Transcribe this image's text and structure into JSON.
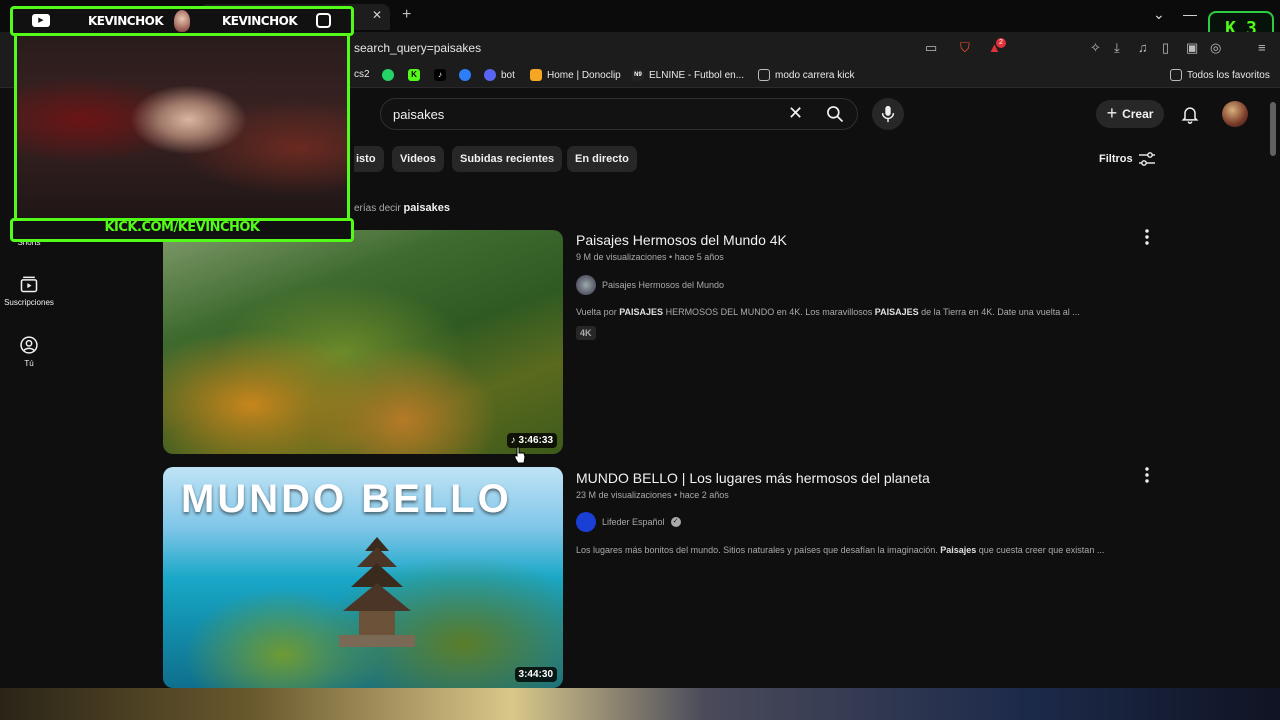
{
  "browser": {
    "url": "search_query=paisakes",
    "badge_letter": "K",
    "badge_count": "3",
    "bookmarks": [
      {
        "label": "cs2",
        "icon": "bookmark-icon"
      },
      {
        "label": "",
        "icon": "whatsapp-icon"
      },
      {
        "label": "",
        "icon": "tiktok-icon"
      },
      {
        "label": "",
        "icon": "kick-icon"
      },
      {
        "label": "",
        "icon": "tiktok-icon"
      },
      {
        "label": "",
        "icon": "chrome-icon"
      },
      {
        "label": "bot",
        "icon": "discord-icon"
      },
      {
        "label": "Home | Donoclip",
        "icon": "donoclip-icon"
      },
      {
        "label": "ELNINE - Futbol en...",
        "icon": "elnine-icon"
      },
      {
        "label": "modo carrera kick",
        "icon": "folder-icon"
      },
      {
        "label": "Todos los favoritos",
        "icon": "folder-icon"
      }
    ],
    "brave_badge": "2"
  },
  "overlay": {
    "name_left": "KEVINCHOK",
    "name_right": "KEVINCHOK",
    "url": "KICK.COM/KEVINCHOK"
  },
  "youtube": {
    "search_value": "paisakes",
    "create_label": "Crear",
    "chips": [
      "isto",
      "Videos",
      "Subidas recientes",
      "En directo"
    ],
    "filters_label": "Filtros",
    "did_you_mean_prefix": "erías decir",
    "did_you_mean_term": "paisakes",
    "sidebar": [
      {
        "label": "Shorts"
      },
      {
        "label": "Suscripciones"
      },
      {
        "label": "Tú"
      }
    ],
    "results": [
      {
        "title": "Paisajes Hermosos del Mundo 4K",
        "meta": "9 M de visualizaciones • hace 5 años",
        "channel": "Paisajes Hermosos del Mundo",
        "desc_parts": [
          "Vuelta por ",
          "PAISAJES",
          " HERMOSOS DEL MUNDO en 4K. Los maravillosos ",
          "PAISAJES",
          " de la Tierra en 4K. Date una vuelta al ..."
        ],
        "badge": "4K",
        "duration": "3:46:33"
      },
      {
        "title": "MUNDO BELLO | Los lugares más hermosos del planeta",
        "meta": "23 M de visualizaciones • hace 2 años",
        "channel": "Lifeder Español",
        "desc_parts": [
          "Los lugares más bonitos del mundo. Sitios naturales y países que desafían la imaginación. ",
          "Paisajes",
          " que cuesta creer que existan ..."
        ],
        "thumb_text": "MUNDO BELLO",
        "duration": "3:44:30"
      }
    ]
  },
  "colors": {
    "kick_green": "#53fc18",
    "yt_bg": "#0f0f0f",
    "chip_bg": "#272727"
  }
}
